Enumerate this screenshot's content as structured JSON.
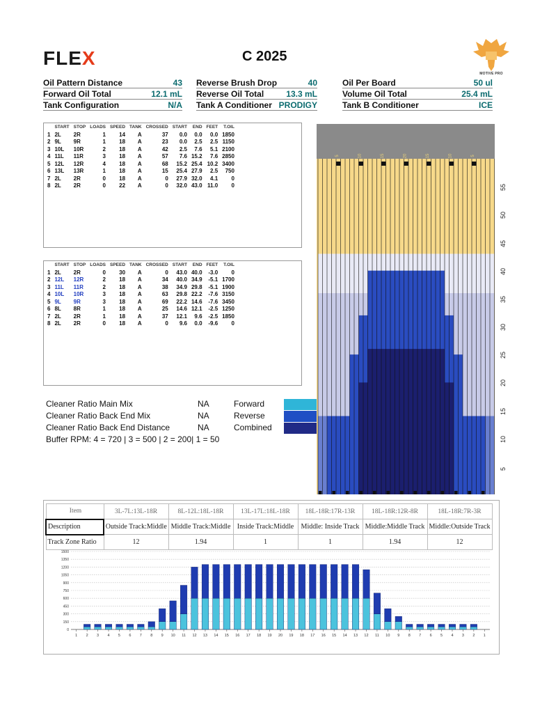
{
  "header": {
    "logo_text": "FLE",
    "logo_x": "X",
    "title": "C 2025",
    "brand_caption": "MOTIVE PRO"
  },
  "specs": [
    {
      "label": "Oil Pattern Distance",
      "value": "43"
    },
    {
      "label": "Forward Oil Total",
      "value": "12.1 mL"
    },
    {
      "label": "Tank Configuration",
      "value": "N/A"
    },
    {
      "label": "Reverse Brush Drop",
      "value": "40"
    },
    {
      "label": "Reverse Oil Total",
      "value": "13.3 mL"
    },
    {
      "label": "Tank A Conditioner",
      "value": "PRODIGY"
    },
    {
      "label": "Oil Per Board",
      "value": "50 ul"
    },
    {
      "label": "Volume Oil Total",
      "value": "25.4 mL"
    },
    {
      "label": "Tank B Conditioner",
      "value": "ICE"
    }
  ],
  "forward_steps": {
    "headers": [
      "",
      "START",
      "STOP",
      "LOADS",
      "SPEED",
      "TANK",
      "CROSSED",
      "START",
      "END",
      "FEET",
      "T.OIL"
    ],
    "rows": [
      [
        "1",
        "2L",
        "2R",
        "1",
        "14",
        "A",
        "37",
        "0.0",
        "0.0",
        "0.0",
        "1850"
      ],
      [
        "2",
        "9L",
        "9R",
        "1",
        "18",
        "A",
        "23",
        "0.0",
        "2.5",
        "2.5",
        "1150"
      ],
      [
        "3",
        "10L",
        "10R",
        "2",
        "18",
        "A",
        "42",
        "2.5",
        "7.6",
        "5.1",
        "2100"
      ],
      [
        "4",
        "11L",
        "11R",
        "3",
        "18",
        "A",
        "57",
        "7.6",
        "15.2",
        "7.6",
        "2850"
      ],
      [
        "5",
        "12L",
        "12R",
        "4",
        "18",
        "A",
        "68",
        "15.2",
        "25.4",
        "10.2",
        "3400"
      ],
      [
        "6",
        "13L",
        "13R",
        "1",
        "18",
        "A",
        "15",
        "25.4",
        "27.9",
        "2.5",
        "750"
      ],
      [
        "7",
        "2L",
        "2R",
        "0",
        "18",
        "A",
        "0",
        "27.9",
        "32.0",
        "4.1",
        "0"
      ],
      [
        "8",
        "2L",
        "2R",
        "0",
        "22",
        "A",
        "0",
        "32.0",
        "43.0",
        "11.0",
        "0"
      ]
    ]
  },
  "reverse_steps": {
    "headers": [
      "",
      "START",
      "STOP",
      "LOADS",
      "SPEED",
      "TANK",
      "CROSSED",
      "START",
      "END",
      "FEET",
      "T.OIL"
    ],
    "rows": [
      [
        "1",
        "2L",
        "2R",
        "0",
        "30",
        "A",
        "0",
        "43.0",
        "40.0",
        "-3.0",
        "0"
      ],
      [
        "2",
        "12L",
        "12R",
        "2",
        "18",
        "A",
        "34",
        "40.0",
        "34.9",
        "-5.1",
        "1700"
      ],
      [
        "3",
        "11L",
        "11R",
        "2",
        "18",
        "A",
        "38",
        "34.9",
        "29.8",
        "-5.1",
        "1900"
      ],
      [
        "4",
        "10L",
        "10R",
        "3",
        "18",
        "A",
        "63",
        "29.8",
        "22.2",
        "-7.6",
        "3150"
      ],
      [
        "5",
        "9L",
        "9R",
        "3",
        "18",
        "A",
        "69",
        "22.2",
        "14.6",
        "-7.6",
        "3450"
      ],
      [
        "6",
        "8L",
        "8R",
        "1",
        "18",
        "A",
        "25",
        "14.6",
        "12.1",
        "-2.5",
        "1250"
      ],
      [
        "7",
        "2L",
        "2R",
        "1",
        "18",
        "A",
        "37",
        "12.1",
        "9.6",
        "-2.5",
        "1850"
      ],
      [
        "8",
        "2L",
        "2R",
        "0",
        "18",
        "A",
        "0",
        "9.6",
        "0.0",
        "-9.6",
        "0"
      ]
    ]
  },
  "cleaner": {
    "main_mix_label": "Cleaner Ratio Main Mix",
    "main_mix_value": "NA",
    "back_end_mix_label": "Cleaner Ratio Back End Mix",
    "back_end_mix_value": "NA",
    "back_end_distance_label": "Cleaner Ratio Back End Distance",
    "back_end_distance_value": "NA",
    "buffer_rpm": "Buffer RPM: 4 = 720 | 3 = 500 | 2 = 200| 1 = 50",
    "legend": [
      {
        "label": "Forward",
        "color": "#2fb5d8"
      },
      {
        "label": "Reverse",
        "color": "#1f4fc4"
      },
      {
        "label": "Combined",
        "color": "#202a86"
      }
    ]
  },
  "pattern_graph": {
    "y_labels": [
      "55",
      "50",
      "45",
      "40",
      "35",
      "30",
      "25",
      "20",
      "15",
      "10",
      "5"
    ],
    "arrow_labels": [
      "5",
      "10",
      "15",
      "20",
      "15",
      "10",
      "5"
    ],
    "colors": {
      "header": "#8a8a8a",
      "dry": "#f7d98a",
      "light": "#c8cbe8",
      "mid": "#2a4cc0",
      "dark": "#1b1f6e",
      "arrow": "#e8d07a"
    }
  },
  "ratio_table": {
    "headers": [
      "Item",
      "3L-7L:13L-18R",
      "8L-12L:18L-18R",
      "13L-17L:18L-18R",
      "18L-18R:17R-13R",
      "18L-18R:12R-8R",
      "18L-18R:7R-3R"
    ],
    "description_label": "Description",
    "descriptions": [
      "Outside Track:Middle",
      "Middle Track:Middle",
      "Inside Track:Middle",
      "Middle: Inside Track",
      "Middle:Middle Track",
      "Middle:Outside Track"
    ],
    "ratio_label": "Track Zone Ratio",
    "ratios": [
      "12",
      "1.94",
      "1",
      "1",
      "1.94",
      "12"
    ]
  },
  "chart_data": {
    "type": "bar",
    "stacked": true,
    "categories": [
      "1",
      "2",
      "3",
      "4",
      "5",
      "6",
      "7",
      "8",
      "9",
      "10",
      "11",
      "12",
      "13",
      "14",
      "15",
      "16",
      "17",
      "18",
      "19",
      "20",
      "19",
      "18",
      "17",
      "16",
      "15",
      "14",
      "13",
      "12",
      "11",
      "10",
      "9",
      "8",
      "7",
      "6",
      "5",
      "4",
      "3",
      "2",
      "1"
    ],
    "series": [
      {
        "color": "#4cc3dd",
        "values": [
          0,
          50,
          50,
          50,
          50,
          50,
          50,
          50,
          150,
          150,
          300,
          600,
          600,
          600,
          600,
          600,
          600,
          600,
          600,
          600,
          600,
          600,
          600,
          600,
          600,
          600,
          600,
          600,
          300,
          150,
          150,
          50,
          50,
          50,
          50,
          50,
          50,
          50,
          0
        ]
      },
      {
        "color": "#1f3cb0",
        "values": [
          0,
          50,
          50,
          50,
          50,
          50,
          50,
          100,
          250,
          400,
          550,
          600,
          650,
          650,
          650,
          650,
          650,
          650,
          650,
          650,
          650,
          650,
          650,
          650,
          650,
          650,
          650,
          550,
          400,
          250,
          100,
          50,
          50,
          50,
          50,
          50,
          50,
          50,
          0
        ]
      }
    ],
    "y_ticks": [
      "0",
      "150",
      "300",
      "450",
      "600",
      "750",
      "900",
      "1050",
      "1200",
      "1350",
      "1500"
    ],
    "ylim": [
      0,
      1500
    ]
  }
}
